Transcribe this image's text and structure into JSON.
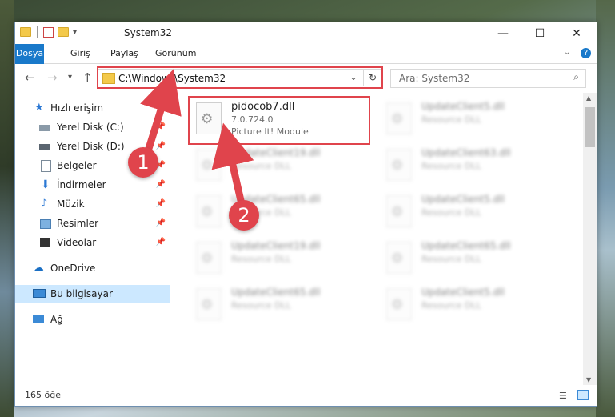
{
  "window": {
    "title": "System32",
    "controls": {
      "minimize": "—",
      "maximize": "☐",
      "close": "✕"
    }
  },
  "ribbon": {
    "tabs": [
      "Dosya",
      "Giriş",
      "Paylaş",
      "Görünüm"
    ]
  },
  "address": {
    "path": "C:\\Windows\\System32",
    "search_placeholder": "Ara: System32"
  },
  "nav": {
    "items": [
      {
        "label": "Hızlı erişim",
        "icon": "star-icon",
        "pinned": false
      },
      {
        "label": "Yerel Disk (C:)",
        "icon": "drive-icon",
        "pinned": true
      },
      {
        "label": "Yerel Disk (D:)",
        "icon": "drive-icon",
        "pinned": true
      },
      {
        "label": "Belgeler",
        "icon": "documents-icon",
        "pinned": true
      },
      {
        "label": "İndirmeler",
        "icon": "download-icon",
        "pinned": true
      },
      {
        "label": "Müzik",
        "icon": "music-icon",
        "pinned": true
      },
      {
        "label": "Resimler",
        "icon": "pictures-icon",
        "pinned": true
      },
      {
        "label": "Videolar",
        "icon": "videos-icon",
        "pinned": true
      },
      {
        "label": "OneDrive",
        "icon": "cloud-icon",
        "pinned": false
      },
      {
        "label": "Bu bilgisayar",
        "icon": "computer-icon",
        "pinned": false,
        "selected": true
      },
      {
        "label": "Ağ",
        "icon": "network-icon",
        "pinned": false
      }
    ]
  },
  "files": [
    {
      "name": "pidocob7.dll",
      "version": "7.0.724.0",
      "description": "Picture It! Module",
      "highlighted": true
    },
    {
      "name": "UpdateClient5.dll",
      "description": "Resource DLL"
    },
    {
      "name": "UpdateClient19.dll",
      "description": "Resource DLL"
    },
    {
      "name": "UpdateClient63.dll",
      "description": "Resource DLL"
    },
    {
      "name": "UpdateClient65.dll",
      "description": "Resource DLL"
    },
    {
      "name": "UpdateClient5.dll",
      "description": "Resource DLL"
    },
    {
      "name": "UpdateClient19.dll",
      "description": "Resource DLL"
    },
    {
      "name": "UpdateClient65.dll",
      "description": "Resource DLL"
    },
    {
      "name": "UpdateClient65.dll",
      "description": "Resource DLL"
    },
    {
      "name": "UpdateClient5.dll",
      "description": "Resource DLL"
    }
  ],
  "status": {
    "item_count": "165 öğe"
  },
  "callouts": [
    "1",
    "2"
  ],
  "colors": {
    "accent": "#1979ca",
    "highlight": "#e0444c",
    "selected_nav": "#cce8ff"
  }
}
